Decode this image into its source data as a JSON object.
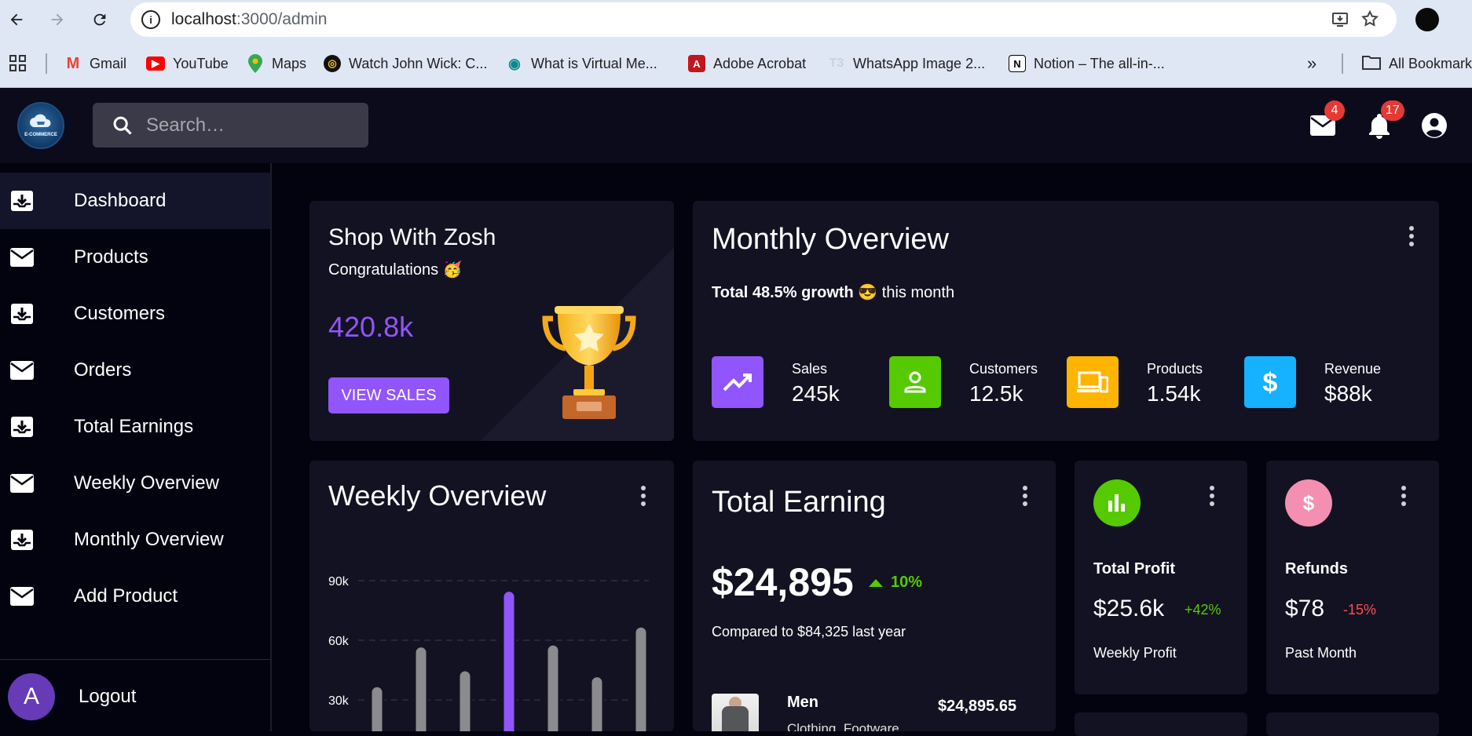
{
  "browser": {
    "url_host": "localhost",
    "url_path": ":3000/admin",
    "bookmarks": [
      {
        "label": "Gmail",
        "icon": "gmail-icon"
      },
      {
        "label": "YouTube",
        "icon": "youtube-icon"
      },
      {
        "label": "Maps",
        "icon": "maps-icon"
      },
      {
        "label": "Watch John Wick: C...",
        "icon": "watch-icon"
      },
      {
        "label": "What is Virtual Me...",
        "icon": "eye-icon"
      },
      {
        "label": "Adobe Acrobat",
        "icon": "acrobat-icon"
      },
      {
        "label": "WhatsApp Image 2...",
        "icon": "image-icon"
      },
      {
        "label": "Notion – The all-in-...",
        "icon": "notion-icon"
      }
    ],
    "all_bookmarks": "All Bookmarks"
  },
  "header": {
    "logo_text": "E-COMMERCE",
    "search_placeholder": "Search…",
    "mail_count": "4",
    "notification_count": "17"
  },
  "sidebar": {
    "items": [
      {
        "label": "Dashboard",
        "icon": "inbox-icon"
      },
      {
        "label": "Products",
        "icon": "mail-icon"
      },
      {
        "label": "Customers",
        "icon": "inbox-icon"
      },
      {
        "label": "Orders",
        "icon": "mail-icon"
      },
      {
        "label": "Total Earnings",
        "icon": "inbox-icon"
      },
      {
        "label": "Weekly Overview",
        "icon": "mail-icon"
      },
      {
        "label": "Monthly Overview",
        "icon": "inbox-icon"
      },
      {
        "label": "Add Product",
        "icon": "mail-icon"
      }
    ],
    "logout": {
      "avatar_letter": "A",
      "label": "Logout"
    }
  },
  "shop_card": {
    "title": "Shop With Zosh",
    "subtitle": "Congratulations 🥳",
    "value": "420.8k",
    "button": "VIEW SALES"
  },
  "monthly": {
    "title": "Monthly Overview",
    "growth_bold": "Total 48.5% growth",
    "growth_emoji": "😎",
    "growth_rest": "this month",
    "stats": [
      {
        "label": "Sales",
        "value": "245k",
        "color": "#9155fd",
        "icon": "trending-up-icon"
      },
      {
        "label": "Customers",
        "value": "12.5k",
        "color": "#56ca00",
        "icon": "person-icon"
      },
      {
        "label": "Products",
        "value": "1.54k",
        "color": "#ffb400",
        "icon": "devices-icon"
      },
      {
        "label": "Revenue",
        "value": "$88k",
        "color": "#16b1ff",
        "icon": "dollar-icon"
      }
    ]
  },
  "weekly": {
    "title": "Weekly Overview"
  },
  "chart_data": {
    "type": "bar",
    "title": "Weekly Overview",
    "y_ticks": [
      "90k",
      "60k",
      "30k"
    ],
    "values": [
      37,
      57,
      45,
      85,
      58,
      42,
      67
    ],
    "highlight_index": 3,
    "ylim": [
      0,
      90
    ],
    "grid": true,
    "bar_color": "#8a8a8f",
    "highlight_color": "#9155fd"
  },
  "earning": {
    "title": "Total Earning",
    "amount": "$24,895",
    "percent": "10%",
    "compare": "Compared to $84,325 last year",
    "item": {
      "category": "Men",
      "sub": "Clothing, Footware",
      "amount": "$24,895.65"
    }
  },
  "profit": {
    "title": "Total Profit",
    "value": "$25.6k",
    "change": "+42%",
    "footer": "Weekly Profit",
    "color": "#56ca00",
    "change_color": "#56ca00",
    "icon": "bar-chart-icon"
  },
  "refunds": {
    "title": "Refunds",
    "value": "$78",
    "change": "-15%",
    "footer": "Past Month",
    "color": "#f48fb1",
    "change_color": "#ff4c51",
    "icon": "dollar-icon"
  }
}
